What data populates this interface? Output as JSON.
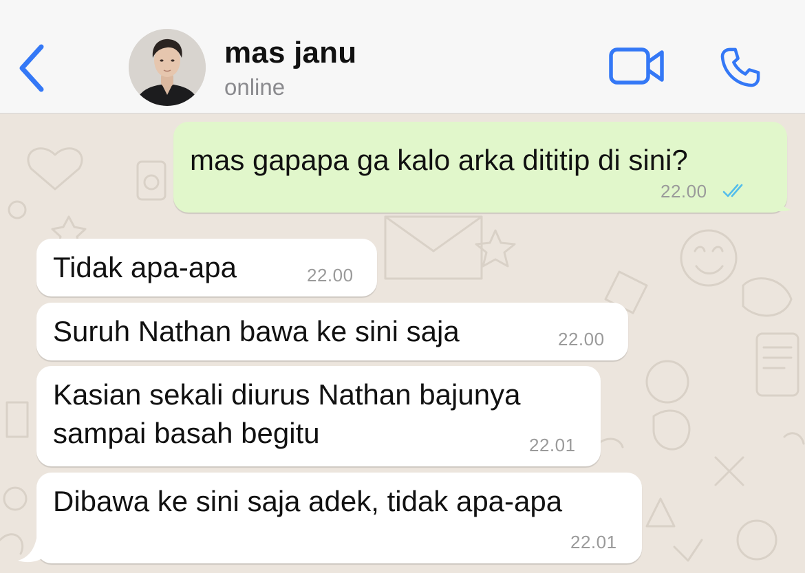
{
  "header": {
    "contact_name": "mas janu",
    "status": "online",
    "back_icon": "chevron-left-icon",
    "video_icon": "video-camera-icon",
    "call_icon": "phone-icon"
  },
  "colors": {
    "accent": "#3478f6",
    "outgoing_bubble": "#e1f7cb",
    "incoming_bubble": "#ffffff",
    "chat_background": "#ece5dd",
    "read_ticks": "#53bdeb"
  },
  "messages": [
    {
      "direction": "out",
      "text": "mas gapapa ga kalo arka dititip di sini?",
      "time": "22.00",
      "status": "read"
    },
    {
      "direction": "in",
      "text": "Tidak apa-apa",
      "time": "22.00"
    },
    {
      "direction": "in",
      "text": "Suruh Nathan bawa ke sini saja",
      "time": "22.00"
    },
    {
      "direction": "in",
      "lines": [
        "Kasian sekali diurus Nathan bajunya",
        "sampai basah begitu"
      ],
      "time": "22.01"
    },
    {
      "direction": "in",
      "text": "Dibawa ke sini saja adek, tidak apa-apa",
      "time": "22.01"
    }
  ]
}
